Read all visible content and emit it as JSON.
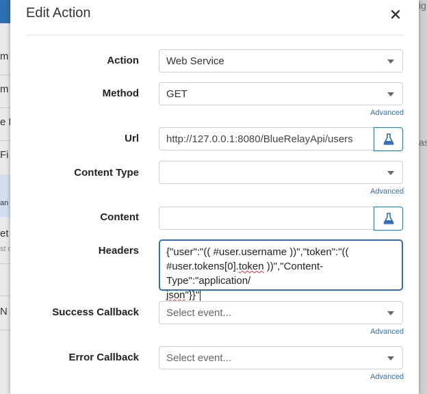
{
  "background": {
    "left_fragments": [
      "m",
      "m",
      "e F",
      "Fi",
      "an",
      "et",
      "st c",
      "N"
    ],
    "right_fragments": [
      "ig",
      "as"
    ]
  },
  "dialog": {
    "title": "Edit Action",
    "close_icon": "close-icon"
  },
  "fields": {
    "action": {
      "label": "Action",
      "value": "Web Service"
    },
    "method": {
      "label": "Method",
      "value": "GET",
      "advanced": "Advanced"
    },
    "url": {
      "label": "Url",
      "value": "http://127.0.0.1:8080/BlueRelayApi/users",
      "test_icon": "flask-icon"
    },
    "content_type": {
      "label": "Content Type",
      "value": "",
      "advanced": "Advanced"
    },
    "content": {
      "label": "Content",
      "value": "",
      "test_icon": "flask-icon"
    },
    "headers": {
      "label": "Headers",
      "line1": "{\"user\":\"(( #user.username ))\",\"token\":\"((",
      "line2_a": "#user.tokens[0].",
      "line2_b": "token",
      "line2_c": " ))\",\"Content-Type\":\"application/",
      "line3_a": "json",
      "line3_b": "\"}}\""
    },
    "success_callback": {
      "label": "Success Callback",
      "placeholder": "Select event...",
      "advanced": "Advanced"
    },
    "error_callback": {
      "label": "Error Callback",
      "placeholder": "Select event...",
      "advanced": "Advanced"
    }
  },
  "colors": {
    "accent": "#2f6fb3",
    "label_text": "#222222",
    "border": "#cfcfcf"
  }
}
